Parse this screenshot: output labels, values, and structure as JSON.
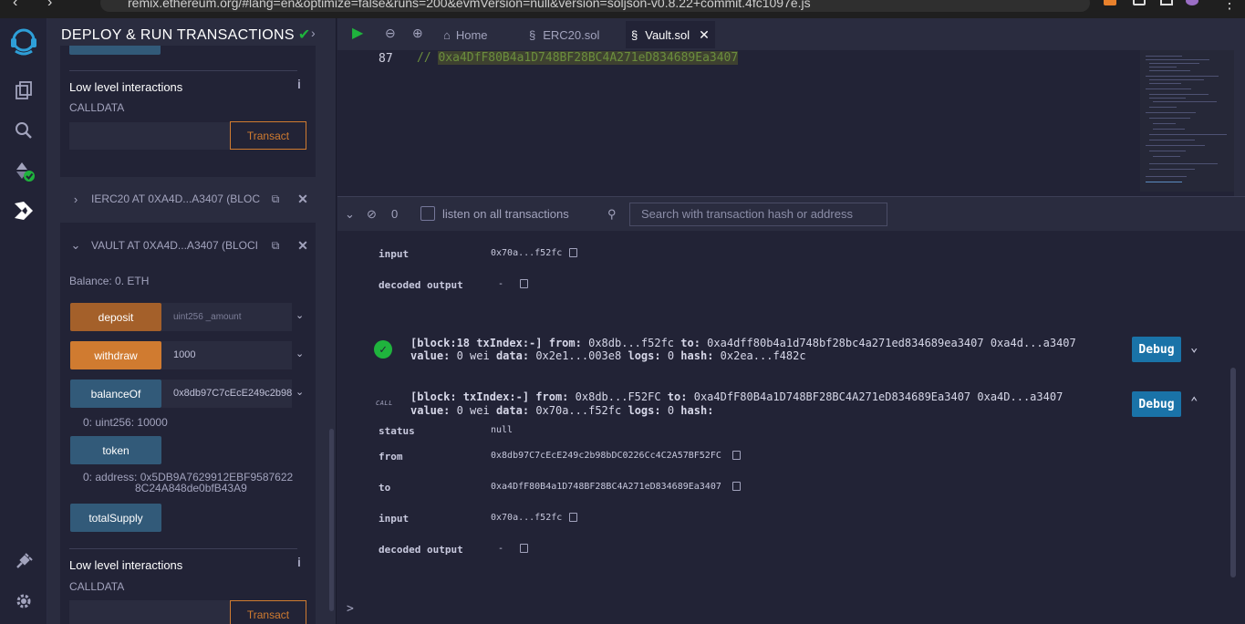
{
  "browser": {
    "url": "remix.ethereum.org/#lang=en&optimize=false&runs=200&evmVersion=null&version=soljson-v0.8.22+commit.4fc1097e.js"
  },
  "icon_panel": {
    "items": [
      "remix-logo-icon",
      "file-explorer-icon",
      "search-icon",
      "solidity-compiler-icon",
      "deploy-run-icon",
      "plugin-manager-icon",
      "settings-icon"
    ]
  },
  "side_panel": {
    "title": "DEPLOY & RUN TRANSACTIONS",
    "top_section": {
      "low_level_title": "Low level interactions",
      "calldata_label": "CALLDATA",
      "transact_label": "Transact"
    },
    "contracts": [
      {
        "name": "IERC20 AT 0XA4D...A3407 (BLOC",
        "expanded": false
      },
      {
        "name": "VAULT AT 0XA4D...A3407 (BLOCI",
        "expanded": true
      }
    ],
    "vault": {
      "balance": "Balance: 0. ETH",
      "functions": [
        {
          "label": "deposit",
          "input": "",
          "placeholder": "uint256 _amount"
        },
        {
          "label": "withdraw",
          "input": "1000",
          "placeholder": ""
        },
        {
          "label": "balanceOf",
          "input": "0x8db97C7cEcE249c2b98",
          "placeholder": ""
        },
        {
          "label": "token",
          "input": "",
          "placeholder": ""
        },
        {
          "label": "totalSupply",
          "input": "",
          "placeholder": ""
        }
      ],
      "balanceOf_result_index": "0:",
      "balanceOf_result": "uint256: 10000",
      "token_result_index": "0:",
      "token_result_line1": "address: 0x5DB9A7629912EBF9587622",
      "token_result_line2": "8C24A848de0bfB43A9",
      "low_level_title": "Low level interactions",
      "calldata_label": "CALLDATA",
      "transact_label": "Transact"
    }
  },
  "editor": {
    "tabs": [
      {
        "label": "Home",
        "icon": "home-icon",
        "active": false
      },
      {
        "label": "ERC20.sol",
        "icon": "solidity-file-icon",
        "active": false
      },
      {
        "label": "Vault.sol",
        "icon": "solidity-file-icon",
        "active": true
      }
    ],
    "line_number": "87",
    "code_prefix": "// ",
    "code_address": "0xa4DfF80B4a1D748BF28BC4A271eD834689Ea3407"
  },
  "terminal_bar": {
    "count": "0",
    "listen_label": "listen on all transactions",
    "search_placeholder": "Search with transaction hash or address"
  },
  "terminal": {
    "prev": {
      "input_key": "input",
      "input_val": "0x70a...f52fc",
      "decoded_key": "decoded output",
      "decoded_val": "-"
    },
    "tx1": {
      "block": "[block:18 txIndex:-]",
      "from_key": "from:",
      "from_val": "0x8db...f52fc",
      "to_key": "to:",
      "to_val": "0xa4dff80b4a1d748bf28bc4a271ed834689ea3407 0xa4d...a3407",
      "value_key": "value:",
      "value_val": "0 wei",
      "data_key": "data:",
      "data_val": "0x2e1...003e8",
      "logs_key": "logs:",
      "logs_val": "0",
      "hash_key": "hash:",
      "hash_val": "0x2ea...f482c",
      "debug": "Debug"
    },
    "tx2": {
      "tag": "CALL",
      "block": "[block: txIndex:-]",
      "from_key": "from:",
      "from_val": "0x8db...F52FC",
      "to_key": "to:",
      "to_val": "0xa4DfF80B4a1D748BF28BC4A271eD834689Ea3407 0xa4D...a3407",
      "value_key": "value:",
      "value_val": "0 wei",
      "data_key": "data:",
      "data_val": "0x70a...f52fc",
      "logs_key": "logs:",
      "logs_val": "0",
      "hash_key": "hash:",
      "debug": "Debug",
      "details": {
        "status_key": "status",
        "status_val": "null",
        "from_key": "from",
        "from_val": "0x8db97C7cEcE249c2b98bDC0226Cc4C2A57BF52FC",
        "to_key": "to",
        "to_val": "0xa4DfF80B4a1D748BF28BC4A271eD834689Ea3407",
        "input_key": "input",
        "input_val": "0x70a...f52fc",
        "decoded_key": "decoded output",
        "decoded_val": "-"
      }
    },
    "prompt": ">"
  },
  "colors": {
    "accent_orange": "#d07b30",
    "deposit_orange": "#a4602a",
    "call_blue": "#325a79",
    "debug_blue": "#1a73a8",
    "success_green": "#1fb33d",
    "bg": "#222336",
    "panel": "#2a2c3f"
  }
}
